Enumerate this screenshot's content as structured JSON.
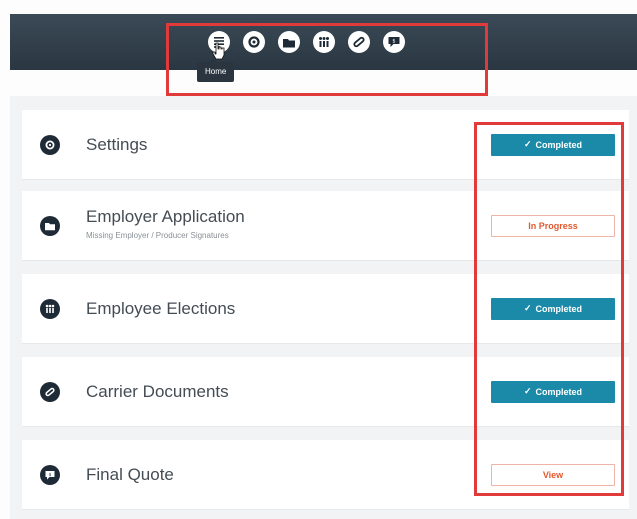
{
  "nav": {
    "icons": [
      {
        "name": "home-icon",
        "label": "Home"
      },
      {
        "name": "settings-icon"
      },
      {
        "name": "application-icon"
      },
      {
        "name": "employees-icon"
      },
      {
        "name": "attachment-icon"
      },
      {
        "name": "quote-icon"
      }
    ],
    "tooltip": "Home"
  },
  "steps": [
    {
      "title": "Settings",
      "subtitle": "",
      "status": "Completed",
      "status_type": "completed",
      "icon": "gear-icon"
    },
    {
      "title": "Employer Application",
      "subtitle": "Missing Employer / Producer Signatures",
      "status": "In Progress",
      "status_type": "in-progress",
      "icon": "folder-icon"
    },
    {
      "title": "Employee Elections",
      "subtitle": "",
      "status": "Completed",
      "status_type": "completed",
      "icon": "people-icon"
    },
    {
      "title": "Carrier Documents",
      "subtitle": "",
      "status": "Completed",
      "status_type": "completed",
      "icon": "paperclip-icon"
    },
    {
      "title": "Final Quote",
      "subtitle": "",
      "status": "View",
      "status_type": "view",
      "icon": "dollar-chat-icon"
    }
  ],
  "colors": {
    "header": "#2f3d48",
    "completed": "#1b8aa8",
    "in_progress_text": "#e2592e",
    "highlight": "#e03a3a"
  }
}
